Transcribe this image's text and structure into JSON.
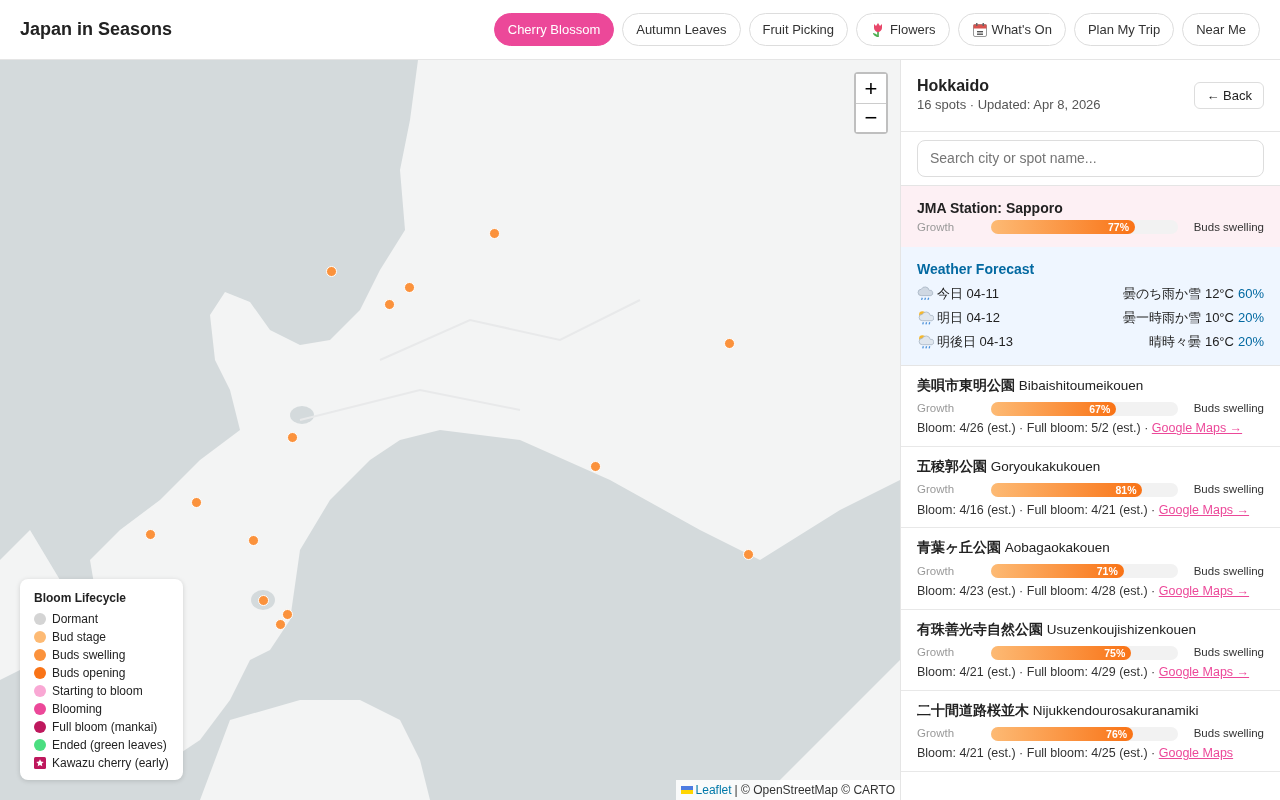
{
  "app": {
    "title": "Japan in Seasons"
  },
  "tabs": [
    {
      "label": "Cherry Blossom",
      "selected": true
    },
    {
      "label": "Autumn Leaves",
      "selected": false
    },
    {
      "label": "Fruit Picking",
      "selected": false
    },
    {
      "label": "Flowers",
      "selected": false,
      "kind": "tulip"
    },
    {
      "label": "What's On",
      "selected": false,
      "kind": "calendar"
    },
    {
      "label": "Plan My Trip",
      "selected": false
    },
    {
      "label": "Near Me",
      "selected": false
    }
  ],
  "map": {
    "zoom_in": "+",
    "zoom_out": "−",
    "attribution_link": "Leaflet",
    "attribution": "| © OpenStreetMap © CARTO",
    "markers": [
      {
        "color": "#fb923c"
      },
      {
        "color": "#fb923c"
      },
      {
        "color": "#fb923c"
      },
      {
        "color": "#fb923c"
      },
      {
        "color": "#fb923c"
      },
      {
        "color": "#fb923c"
      },
      {
        "color": "#fb923c"
      },
      {
        "color": "#fb923c"
      },
      {
        "color": "#fb923c"
      },
      {
        "color": "#fb923c"
      },
      {
        "color": "#fb923c"
      },
      {
        "color": "#fb923c"
      },
      {
        "color": "#fb923c"
      },
      {
        "color": "#fb923c"
      }
    ]
  },
  "legend": {
    "title": "Bloom Lifecycle",
    "items": [
      {
        "label": "Dormant",
        "color": "#d4d4d4",
        "kind": "dot"
      },
      {
        "label": "Bud stage",
        "color": "#fdba74",
        "kind": "dot"
      },
      {
        "label": "Buds swelling",
        "color": "#fb923c",
        "kind": "dot"
      },
      {
        "label": "Buds opening",
        "color": "#f97316",
        "kind": "dot"
      },
      {
        "label": "Starting to bloom",
        "color": "#f9a8d4",
        "kind": "dot"
      },
      {
        "label": "Blooming",
        "color": "#ec4899",
        "kind": "dot"
      },
      {
        "label": "Full bloom (mankai)",
        "color": "#be185d",
        "kind": "dot"
      },
      {
        "label": "Ended (green leaves)",
        "color": "#4ade80",
        "kind": "dot"
      },
      {
        "label": "Kawazu cherry (early)",
        "color": "#be185d",
        "kind": "star"
      }
    ]
  },
  "sidebar": {
    "region": "Hokkaido",
    "subtitle": "16 spots · Updated: Apr 8, 2026",
    "back_button": "← Back",
    "search": {
      "placeholder": "Search city or spot name..."
    },
    "station": {
      "title": "JMA Station: Sapporo",
      "label": "Growth",
      "level": 0.77,
      "percent": "77%",
      "status": "Buds swelling"
    },
    "weather": {
      "title": "Weather Forecast",
      "days": [
        {
          "kind": "sleet",
          "day": "今日 04-11",
          "forecast": "曇のち雨か雪 12°C",
          "chance": "60%"
        },
        {
          "kind": "showers",
          "day": "明日 04-12",
          "forecast": "曇一時雨か雪 10°C",
          "chance": "20%"
        },
        {
          "kind": "showers",
          "day": "明後日 04-13",
          "forecast": "晴時々曇 16°C",
          "chance": "20%"
        }
      ]
    },
    "spots": [
      {
        "name_ja": "美唄市東明公園",
        "name_en": "Bibaishitoumeikouen",
        "label": "Growth",
        "level": 0.67,
        "percent": "67%",
        "status": "Buds swelling",
        "dates": "Bloom: 4/26 (est.) · Full bloom: 5/2 (est.) ·",
        "link": "Google Maps →"
      },
      {
        "name_ja": "五稜郭公園",
        "name_en": "Goryoukakukouen",
        "label": "Growth",
        "level": 0.81,
        "percent": "81%",
        "status": "Buds swelling",
        "dates": "Bloom: 4/16 (est.) · Full bloom: 4/21 (est.) ·",
        "link": "Google Maps →"
      },
      {
        "name_ja": "青葉ヶ丘公園",
        "name_en": "Aobagaokakouen",
        "label": "Growth",
        "level": 0.71,
        "percent": "71%",
        "status": "Buds swelling",
        "dates": "Bloom: 4/23 (est.) · Full bloom: 4/28 (est.) ·",
        "link": "Google Maps →"
      },
      {
        "name_ja": "有珠善光寺自然公園",
        "name_en": "Usuzenkoujishizenkouen",
        "label": "Growth",
        "level": 0.75,
        "percent": "75%",
        "status": "Buds swelling",
        "dates": "Bloom: 4/21 (est.) · Full bloom: 4/29 (est.) ·",
        "link": "Google Maps →"
      },
      {
        "name_ja": "二十間道路桜並木",
        "name_en": "Nijukkendourosakuranamiki",
        "label": "Growth",
        "level": 0.76,
        "percent": "76%",
        "status": "Buds swelling",
        "dates": "Bloom: 4/21 (est.) · Full bloom: 4/25 (est.) ·",
        "link": "Google Maps"
      }
    ]
  }
}
